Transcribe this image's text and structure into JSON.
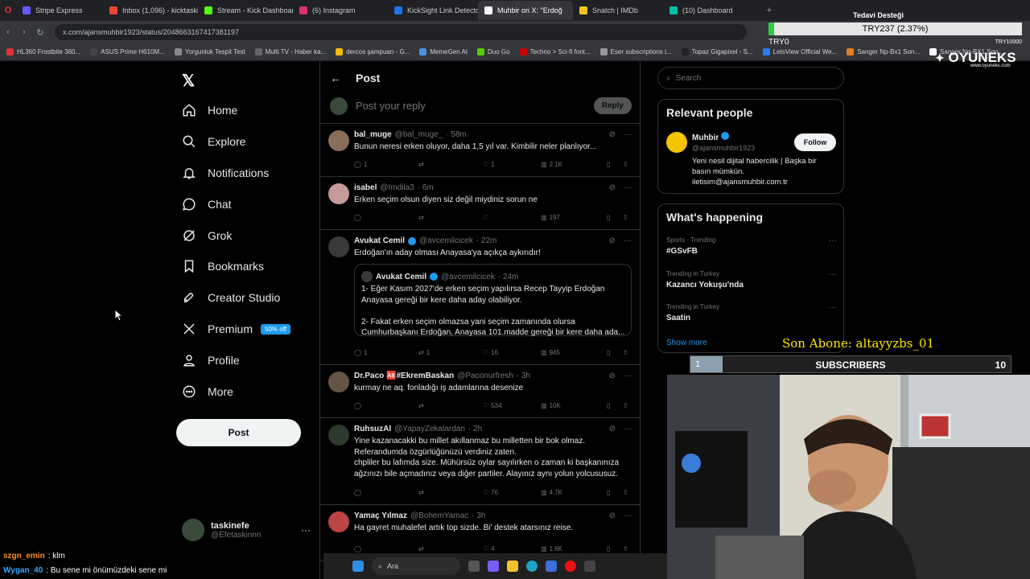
{
  "browser": {
    "tabs": [
      {
        "label": "Stripe Express",
        "color": "#635bff",
        "active": false
      },
      {
        "label": "Inbox (1,096) - kicktaskine",
        "color": "#ea4335",
        "active": false
      },
      {
        "label": "Stream - Kick Dashboard",
        "color": "#53fc18",
        "active": false
      },
      {
        "label": "(6) Instagram",
        "color": "#e1306c",
        "active": false
      },
      {
        "label": "KickSight Link Detector",
        "color": "#1a73e8",
        "active": false
      },
      {
        "label": "Muhbir on X: \"Erdoğ",
        "color": "#ffffff",
        "active": true
      },
      {
        "label": "Snatch | IMDb",
        "color": "#f5c518",
        "active": false
      },
      {
        "label": "(10) Dashboard",
        "color": "#00c2a8",
        "active": false
      }
    ],
    "url": "x.com/ajansmuhbir1923/status/2048663167417381197",
    "bookmarks": [
      {
        "label": "HL360 Frostbite 360...",
        "color": "#d33"
      },
      {
        "label": "ASUS Prime H610M...",
        "color": "#444"
      },
      {
        "label": "Yorgunluk Tespit Test",
        "color": "#888"
      },
      {
        "label": "Multi TV - Haber ka...",
        "color": "#666"
      },
      {
        "label": "dercos şampuan - G...",
        "color": "#fbbc05"
      },
      {
        "label": "MemeGen AI",
        "color": "#4a90e2"
      },
      {
        "label": "Duo Go",
        "color": "#58cc02"
      },
      {
        "label": "Techno > Sci-fi font...",
        "color": "#c00"
      },
      {
        "label": "Eser subscriptions i...",
        "color": "#999"
      },
      {
        "label": "Topaz Gigapixel - S...",
        "color": "#222"
      },
      {
        "label": "LetsView Official We...",
        "color": "#2b7de9"
      },
      {
        "label": "Sanger Np-Bx1 Son...",
        "color": "#e67e22"
      },
      {
        "label": "Sanger Np-BX1 Son...",
        "color": "#fff"
      }
    ]
  },
  "nav": {
    "items": [
      {
        "label": "Home",
        "icon": "home-icon"
      },
      {
        "label": "Explore",
        "icon": "search-icon"
      },
      {
        "label": "Notifications",
        "icon": "bell-icon"
      },
      {
        "label": "Chat",
        "icon": "chat-icon"
      },
      {
        "label": "Grok",
        "icon": "grok-icon"
      },
      {
        "label": "Bookmarks",
        "icon": "bookmark-icon"
      },
      {
        "label": "Creator Studio",
        "icon": "rocket-icon"
      },
      {
        "label": "Premium",
        "icon": "x-icon"
      },
      {
        "label": "Profile",
        "icon": "person-icon"
      },
      {
        "label": "More",
        "icon": "more-icon"
      }
    ],
    "premium_badge": "50% off",
    "post_label": "Post",
    "account": {
      "name": "taskinefe",
      "handle": "@Efetaskinnn"
    }
  },
  "center": {
    "title": "Post",
    "reply_placeholder": "Post your reply",
    "reply_button": "Reply",
    "tweets": [
      {
        "name": "bal_muge",
        "handle": "@bal_muge_",
        "time": "· 58m",
        "text": "Bunun neresi erken oluyor, daha 1,5 yıl var. Kimbilir neler planlıyor...",
        "replies": "1",
        "retweets": "",
        "likes": "1",
        "views": "2.1K",
        "verified": false
      },
      {
        "name": "isabel",
        "handle": "@Imdila3",
        "time": "· 6m",
        "text": "Erken seçim olsun diyen siz değil miydiniz  sorun ne",
        "replies": "",
        "retweets": "",
        "likes": "",
        "views": "197",
        "verified": false
      },
      {
        "name": "Avukat Cemil",
        "handle": "@avcemilcicek",
        "time": "· 22m",
        "text": "Erdoğan'ın aday olması Anayasa'ya açıkça aykırıdır!",
        "replies": "1",
        "retweets": "1",
        "likes": "16",
        "views": "945",
        "verified": true,
        "quote": {
          "name": "Avukat Cemil",
          "handle": "@avcemilcicek",
          "time": "· 24m",
          "text": "1- Eğer Kasım 2027'de erken seçim yapılırsa Recep Tayyip Erdoğan Anayasa gereği bir kere daha aday olabiliyor.\n\n2- Fakat erken seçim olmazsa yani seçim zamanında olursa Cumhurbaşkanı Erdoğan, Anayasa 101.madde gereği bir kere daha ada..."
        }
      },
      {
        "name": "Dr.Paco 🆎#EkremBaskan",
        "handle": "@Paconurfresh",
        "time": "· 3h",
        "text": "kurmay ne aq. fonladığı iş adamlarına desenize",
        "replies": "",
        "retweets": "",
        "likes": "534",
        "views": "10K",
        "verified": false
      },
      {
        "name": "RuhsuzAI",
        "handle": "@YapayZekalardan",
        "time": "· 2h",
        "text": "Yine kazanacakki bu millet akıllanmaz bu milletten bir bok olmaz.\nReferandumda özgürlüğünüzü verdiniz zaten.\nchpliler bu lafımda size. Mühürsüz oylar sayılırken o zaman ki başkanınıza ağzınızı bile açmadınız veya diğer partiler. Alayınız aynı yolun yolcususuz.",
        "replies": "",
        "retweets": "",
        "likes": "76",
        "views": "4.7K",
        "verified": false
      },
      {
        "name": "Yamaç Yılmaz",
        "handle": "@BohemYamac",
        "time": "· 3h",
        "text": "Ha gayret muhalefet artık top sizde. Bi' destek atarsınız reise.",
        "replies": "",
        "retweets": "",
        "likes": "4",
        "views": "1.6K",
        "verified": false
      }
    ]
  },
  "right": {
    "search_placeholder": "Search",
    "relevant_title": "Relevant people",
    "person": {
      "name": "Muhbir",
      "handle": "@ajansmuhbir1923",
      "bio": "Yeni nesil dijital habercilik | Başka bir basın mümkün.\niletisim@ajansmuhbir.com.tr",
      "follow": "Follow"
    },
    "happening_title": "What's happening",
    "trends": [
      {
        "category": "Sports · Trending",
        "name": "#GSvFB"
      },
      {
        "category": "Trending in Turkey",
        "name": "Kazancı Yokuşu'nda"
      },
      {
        "category": "Trending in Turkey",
        "name": "Saatin"
      }
    ],
    "show_more": "Show more"
  },
  "overlay": {
    "tedavi": "Tedavi Desteği",
    "try_amount": "TRY237 (2.37%)",
    "try_progress_percent": 2.37,
    "try_label": "TRY0",
    "try_goal": "TRY10000",
    "brand": "OYUNEKS",
    "brand_url": "www.oyuneks.com",
    "son_abone": "Son Abone: altayyzbs_01",
    "sub_count": "1",
    "sub_label": "SUBSCRIBERS",
    "sub_goal": "10",
    "sub_progress_fraction": 0.1
  },
  "chat": [
    {
      "user": "szgn_emin",
      "message": ": klm"
    },
    {
      "user": "Wygan_40",
      "message": ": Bu sene mi önümüzdeki sene mi"
    }
  ],
  "taskbar": {
    "search": "Ara"
  }
}
